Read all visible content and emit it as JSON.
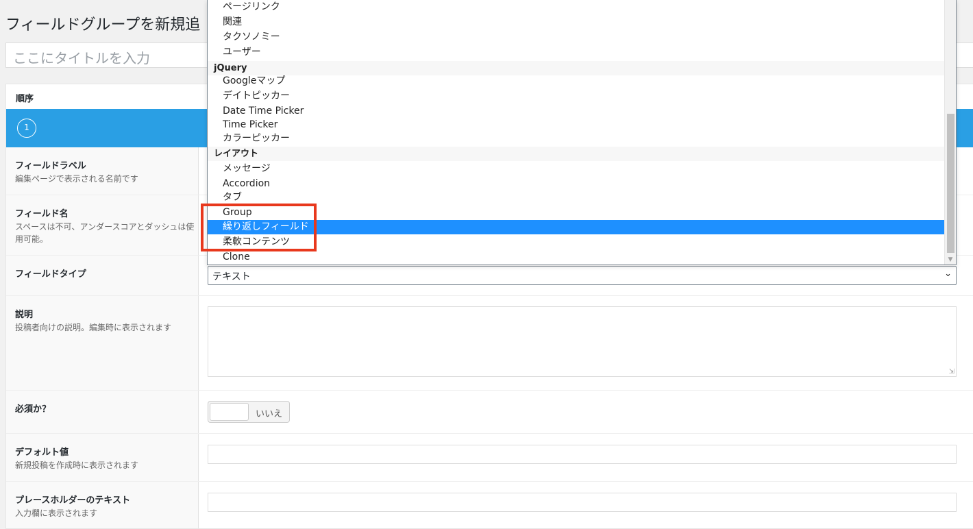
{
  "page": {
    "title": "フィールドグループを新規追",
    "title_placeholder": "ここにタイトルを入力"
  },
  "field_header": {
    "order_label": "順序",
    "order_number": "1"
  },
  "settings": {
    "field_label": {
      "label": "フィールドラベル",
      "desc": "編集ページで表示される名前です"
    },
    "field_name": {
      "label": "フィールド名",
      "desc": "スペースは不可、アンダースコアとダッシュは使用可能。"
    },
    "field_type": {
      "label": "フィールドタイプ",
      "value": "テキスト"
    },
    "instructions": {
      "label": "説明",
      "desc": "投稿者向けの説明。編集時に表示されます"
    },
    "required": {
      "label": "必須か？",
      "toggle_text": "いいえ"
    },
    "default_value": {
      "label": "デフォルト値",
      "desc": "新規投稿を作成時に表示されます"
    },
    "placeholder": {
      "label": "プレースホルダーのテキスト",
      "desc": "入力欄に表示されます"
    }
  },
  "dropdown": {
    "items": [
      {
        "text": "ページリンク",
        "kind": "option"
      },
      {
        "text": "関連",
        "kind": "option"
      },
      {
        "text": "タクソノミー",
        "kind": "option"
      },
      {
        "text": "ユーザー",
        "kind": "option"
      },
      {
        "text": "jQuery",
        "kind": "group"
      },
      {
        "text": "Googleマップ",
        "kind": "option"
      },
      {
        "text": "デイトピッカー",
        "kind": "option"
      },
      {
        "text": "Date Time Picker",
        "kind": "option"
      },
      {
        "text": "Time Picker",
        "kind": "option"
      },
      {
        "text": "カラーピッカー",
        "kind": "option"
      },
      {
        "text": "レイアウト",
        "kind": "group"
      },
      {
        "text": "メッセージ",
        "kind": "option"
      },
      {
        "text": "Accordion",
        "kind": "option"
      },
      {
        "text": "タブ",
        "kind": "option"
      },
      {
        "text": "Group",
        "kind": "option"
      },
      {
        "text": "繰り返しフィールド",
        "kind": "option",
        "selected": true
      },
      {
        "text": "柔軟コンテンツ",
        "kind": "option"
      },
      {
        "text": "Clone",
        "kind": "option"
      }
    ]
  },
  "colors": {
    "accent": "#2a9fe4",
    "selection": "#1e90ff",
    "highlight": "#e8381d"
  }
}
